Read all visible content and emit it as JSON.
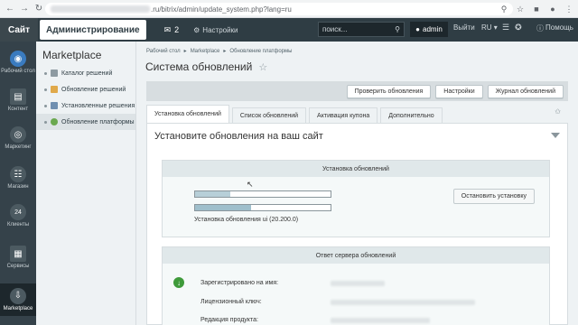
{
  "browser": {
    "url_visible": ".ru/bitrix/admin/update_system.php?lang=ru"
  },
  "topbar": {
    "site": "Сайт",
    "admin": "Администрирование",
    "notifications_count": "2",
    "settings": "Настройки",
    "search_placeholder": "поиск...",
    "user": "admin",
    "logout": "Выйти",
    "lang": "RU",
    "help": "Помощь"
  },
  "leftmenu": {
    "items": [
      {
        "label": "Рабочий стол",
        "icon": "desktop-icon"
      },
      {
        "label": "Контент",
        "icon": "content-icon"
      },
      {
        "label": "Маркетинг",
        "icon": "target-icon"
      },
      {
        "label": "Магазин",
        "icon": "cart-icon"
      },
      {
        "label": "Клиенты",
        "icon": "clock-24-icon"
      },
      {
        "label": "Сервисы",
        "icon": "services-icon"
      },
      {
        "label": "Marketplace",
        "icon": "cloud-download-icon"
      }
    ]
  },
  "submenu": {
    "title": "Marketplace",
    "items": [
      {
        "label": "Каталог решений"
      },
      {
        "label": "Обновление решений"
      },
      {
        "label": "Установленные решения"
      },
      {
        "label": "Обновление платформы"
      }
    ]
  },
  "main": {
    "breadcrumb": [
      "Рабочий стол",
      "Marketplace",
      "Обновление платформы"
    ],
    "title": "Система обновлений",
    "toolbar": {
      "check_updates": "Проверить обновления",
      "settings": "Настройки",
      "journal": "Журнал обновлений"
    },
    "tabs": [
      "Установка обновлений",
      "Список обновлений",
      "Активация купона",
      "Дополнительно"
    ],
    "section_title": "Установите обновления на ваш сайт",
    "install_box": {
      "header": "Установка обновлений",
      "progress1": 0.26,
      "progress2": 0.41,
      "text": "Установка обновления ui (20.200.0)",
      "stop_button": "Остановить установку"
    },
    "server_box": {
      "header": "Ответ сервера обновлений",
      "rows": [
        "Зарегистрировано на имя:",
        "Лицензионный ключ:",
        "Редакция продукта:"
      ]
    }
  }
}
